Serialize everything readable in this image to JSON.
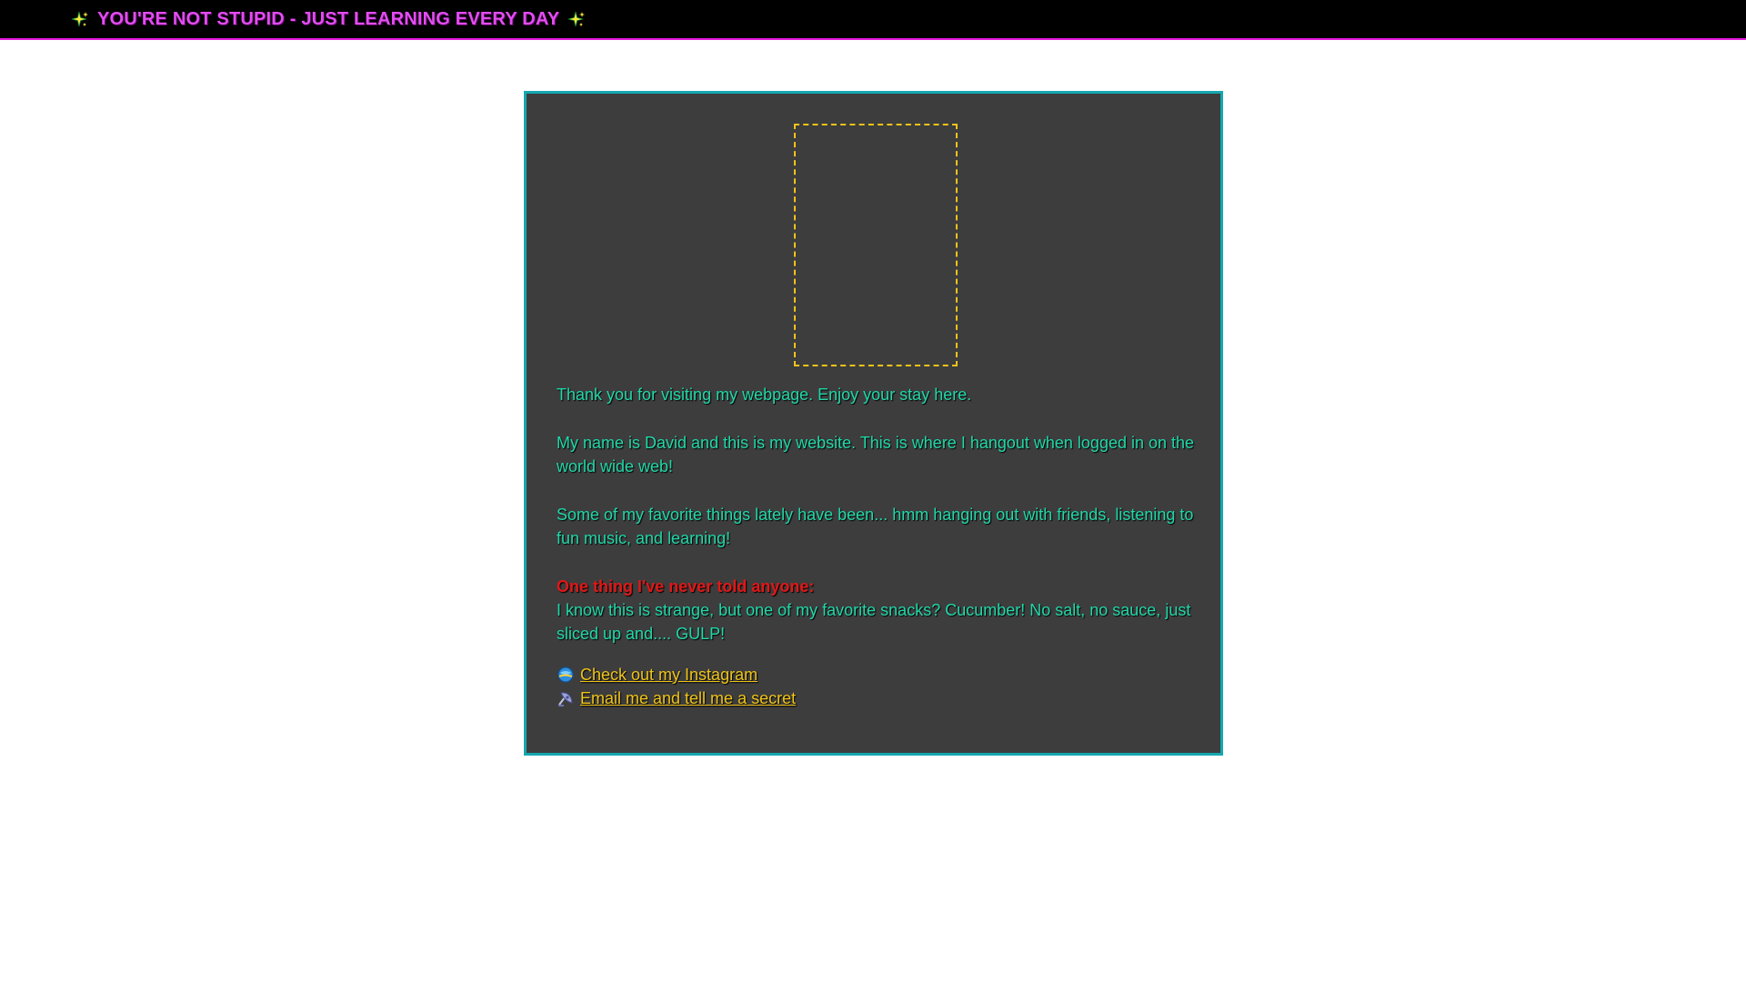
{
  "header": {
    "title": "YOU'RE NOT STUPID - JUST LEARNING EVERY DAY",
    "left_icon": "sparkle-icon",
    "right_icon": "sparkle-icon"
  },
  "colors": {
    "header_bg": "#000000",
    "header_border": "#e619e0",
    "title_color": "#e14df0",
    "panel_bg": "#3d3d3d",
    "panel_border": "#14a8b0",
    "body_text": "#20d8a8",
    "secret_heading": "#e01818",
    "link_color": "#f0c419",
    "photo_frame_border": "#f0c419"
  },
  "main": {
    "photo_frame_icon": "image-placeholder-icon",
    "paragraphs": [
      "Thank you for visiting my webpage. Enjoy your stay here.",
      "My name is David and this is my website. This is where I hangout when logged in on the world wide web!",
      "Some of my favorite things lately have been... hmm hanging out with friends, listening to fun music, and learning!"
    ],
    "secret": {
      "heading": "One thing I've never told anyone:",
      "text": "I know this is strange, but one of my favorite snacks? Cucumber! No salt, no sauce, just sliced up and.... GULP!"
    },
    "links": [
      {
        "label": "Check out my Instagram",
        "icon": "globe-icon"
      },
      {
        "label": "Email me and tell me a secret",
        "icon": "satellite-dish-icon"
      }
    ]
  }
}
